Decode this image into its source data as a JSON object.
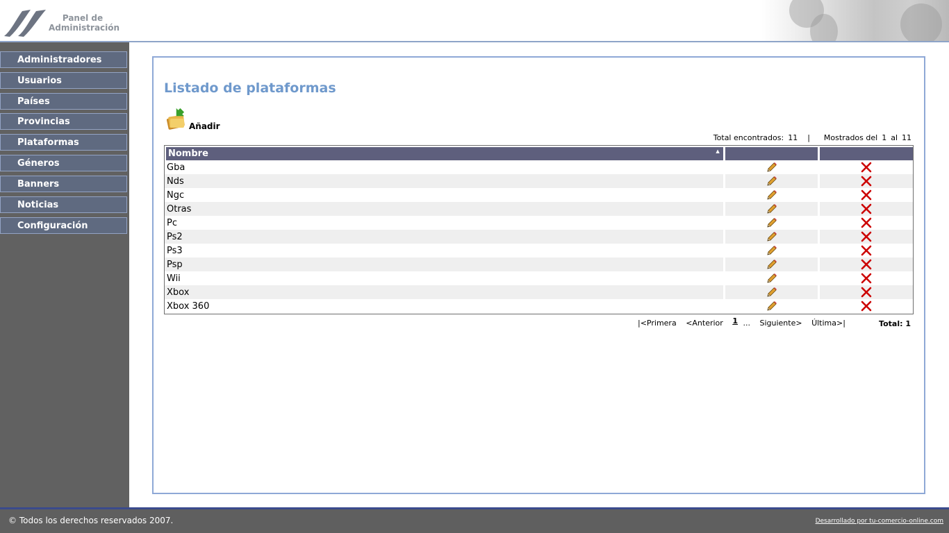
{
  "header": {
    "logo_line1": "Panel de",
    "logo_line2": "Administración"
  },
  "sidebar": {
    "items": [
      {
        "label": "Administradores"
      },
      {
        "label": "Usuarios"
      },
      {
        "label": "Países"
      },
      {
        "label": "Provincias"
      },
      {
        "label": "Plataformas"
      },
      {
        "label": "Géneros"
      },
      {
        "label": "Banners"
      },
      {
        "label": "Noticias"
      },
      {
        "label": "Configuración"
      }
    ]
  },
  "main": {
    "title": "Listado de plataformas",
    "add_label": "Añadir",
    "summary": {
      "total_label": "Total encontrados:",
      "total_value": "11",
      "separator": "|",
      "shown_label": "Mostrados del",
      "shown_from": "1",
      "shown_to_label": "al",
      "shown_to": "11"
    },
    "table": {
      "header_name": "Nombre",
      "sort_glyph": "▲",
      "rows": [
        "Gba",
        "Nds",
        "Ngc",
        "Otras",
        "Pc",
        "Ps2",
        "Ps3",
        "Psp",
        "Wii",
        "Xbox",
        "Xbox 360"
      ]
    },
    "pagination": {
      "first": "|<Primera",
      "prev": "<Anterior",
      "current": "1",
      "dots": "...",
      "next": "Siguiente>",
      "last": "Última>|",
      "total_label": "Total:",
      "total_value": "1"
    }
  },
  "footer": {
    "copyright": "© Todos los derechos reservados 2007.",
    "developer": "Desarrollado por tu-comercio-online.com"
  },
  "colors": {
    "menu_bg": "#5f6a80",
    "title": "#6f99cc",
    "table_header": "#5e5f7d",
    "delete_icon": "#cc0000"
  },
  "icons": {
    "edit": "pencil-icon",
    "delete": "delete-x-icon",
    "add": "add-folder-icon"
  }
}
